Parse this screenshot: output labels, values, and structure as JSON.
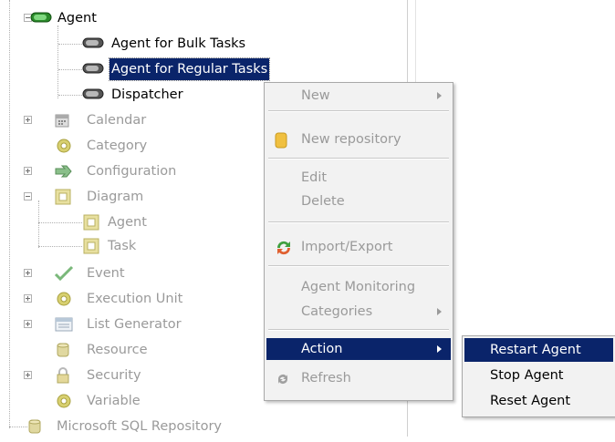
{
  "tree": {
    "nodes": [
      {
        "label": "Agent"
      },
      {
        "label": "Agent for Bulk Tasks"
      },
      {
        "label": "Agent for Regular Tasks"
      },
      {
        "label": "Dispatcher"
      },
      {
        "label": "Calendar"
      },
      {
        "label": "Category"
      },
      {
        "label": "Configuration"
      },
      {
        "label": "Diagram"
      },
      {
        "label": "Agent"
      },
      {
        "label": "Task"
      },
      {
        "label": "Event"
      },
      {
        "label": "Execution Unit"
      },
      {
        "label": "List Generator"
      },
      {
        "label": "Resource"
      },
      {
        "label": "Security"
      },
      {
        "label": "Variable"
      },
      {
        "label": "Microsoft SQL Repository"
      }
    ]
  },
  "context_menu": {
    "items": [
      {
        "label": "New",
        "icon": "none"
      },
      {
        "label": "New repository",
        "icon": "database-icon"
      },
      {
        "label": "Edit"
      },
      {
        "label": "Delete"
      },
      {
        "label": "Import/Export",
        "icon": "import-export-icon"
      },
      {
        "label": "Agent Monitoring"
      },
      {
        "label": "Categories"
      },
      {
        "label": "Action"
      },
      {
        "label": "Refresh",
        "icon": "refresh-icon"
      }
    ]
  },
  "action_submenu": {
    "items": [
      {
        "label": "Restart Agent"
      },
      {
        "label": "Stop Agent"
      },
      {
        "label": "Reset Agent"
      }
    ]
  },
  "colors": {
    "selection": "#0a246a",
    "disabled_text": "#9a9a9a",
    "menu_bg": "#f2f2f2"
  }
}
